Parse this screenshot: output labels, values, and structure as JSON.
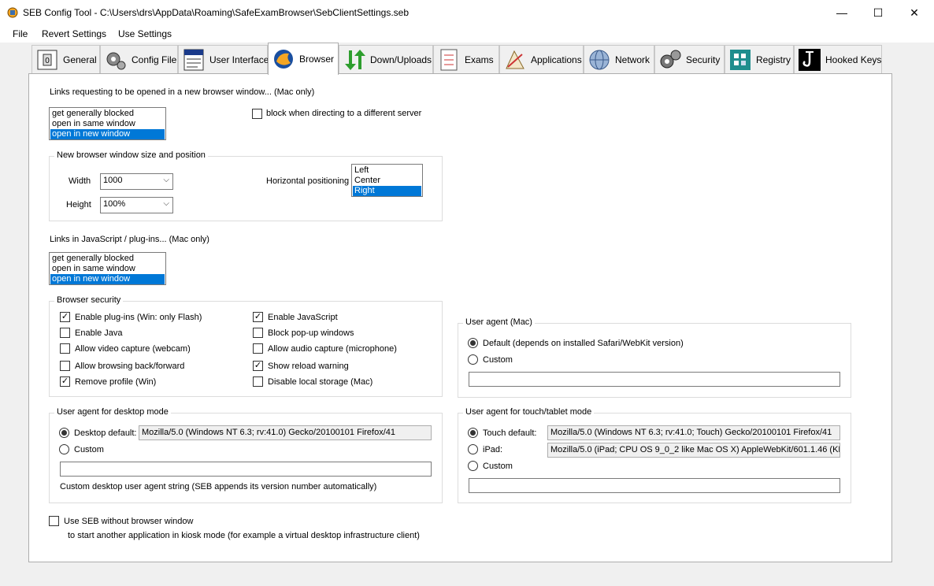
{
  "window": {
    "title": "SEB Config Tool - C:\\Users\\drs\\AppData\\Roaming\\SafeExamBrowser\\SebClientSettings.seb",
    "minimize": "—",
    "maximize": "☐",
    "close": "✕"
  },
  "menu": {
    "file": "File",
    "revert": "Revert Settings",
    "use": "Use Settings"
  },
  "tabs": [
    {
      "label": "General"
    },
    {
      "label": "Config File"
    },
    {
      "label": "User Interface"
    },
    {
      "label": "Browser"
    },
    {
      "label": "Down/Uploads"
    },
    {
      "label": "Exams"
    },
    {
      "label": "Applications"
    },
    {
      "label": "Network"
    },
    {
      "label": "Security"
    },
    {
      "label": "Registry"
    },
    {
      "label": "Hooked Keys"
    }
  ],
  "new_window_links": {
    "label": "Links requesting to be opened in a new browser window... (Mac only)",
    "options": [
      "get generally blocked",
      "open in same window",
      "open in new window"
    ],
    "selected": "open in new window",
    "block_different_server": "block when directing to a different server"
  },
  "window_size": {
    "title": "New browser window size and position",
    "width_label": "Width",
    "width_value": "1000",
    "height_label": "Height",
    "height_value": "100%",
    "hpos_label": "Horizontal positioning",
    "hpos_options": [
      "Left",
      "Center",
      "Right"
    ],
    "hpos_selected": "Right"
  },
  "js_links": {
    "label": "Links in JavaScript / plug-ins... (Mac only)",
    "options": [
      "get generally blocked",
      "open in same window",
      "open in new window"
    ],
    "selected": "open in new window"
  },
  "browser_security": {
    "title": "Browser security",
    "items": [
      {
        "label": "Enable plug-ins (Win: only Flash)",
        "checked": true
      },
      {
        "label": "Enable Java",
        "checked": false
      },
      {
        "label": "Allow video capture (webcam)",
        "checked": false
      },
      {
        "label": "Allow browsing back/forward",
        "checked": false
      },
      {
        "label": "Remove profile (Win)",
        "checked": true
      },
      {
        "label": "Enable JavaScript",
        "checked": true
      },
      {
        "label": "Block pop-up windows",
        "checked": false
      },
      {
        "label": "Allow audio capture (microphone)",
        "checked": false
      },
      {
        "label": "Show reload warning",
        "checked": true
      },
      {
        "label": "Disable local storage (Mac)",
        "checked": false
      }
    ]
  },
  "ua_mac": {
    "title": "User agent (Mac)",
    "default_label": "Default (depends on installed Safari/WebKit version)",
    "custom_label": "Custom",
    "custom_value": ""
  },
  "ua_desktop": {
    "title": "User agent for desktop mode",
    "default_label": "Desktop default:",
    "default_value": "Mozilla/5.0 (Windows NT 6.3; rv:41.0) Gecko/20100101 Firefox/41",
    "custom_label": "Custom",
    "custom_value": "",
    "hint": "Custom desktop user agent string (SEB appends its version number automatically)"
  },
  "ua_touch": {
    "title": "User agent for touch/tablet mode",
    "default_label": "Touch default:",
    "default_value": "Mozilla/5.0 (Windows NT 6.3; rv:41.0; Touch) Gecko/20100101 Firefox/41",
    "ipad_label": "iPad:",
    "ipad_value": "Mozilla/5.0 (iPad; CPU OS 9_0_2 like Mac OS X) AppleWebKit/601.1.46 (KH",
    "custom_label": "Custom",
    "custom_value": ""
  },
  "no_browser": {
    "label": "Use SEB without browser window",
    "sub": "to start another application in kiosk mode (for example a virtual desktop infrastructure client)"
  },
  "colors": {
    "selection": "#0078d7",
    "border": "#adadad"
  }
}
